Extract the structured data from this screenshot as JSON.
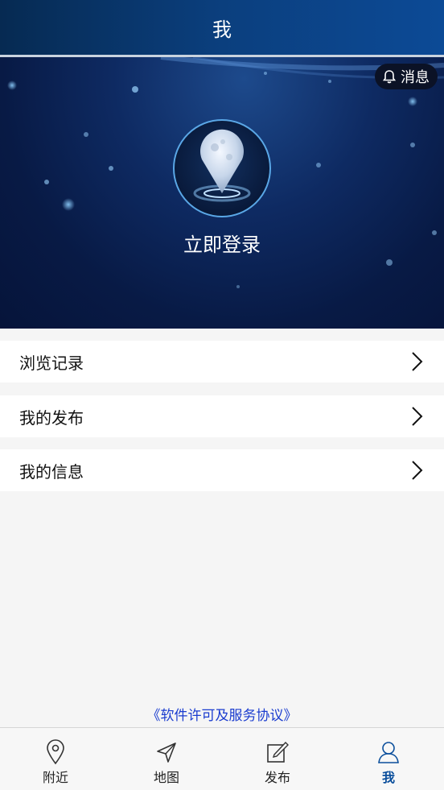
{
  "header": {
    "title": "我"
  },
  "banner": {
    "message_button_label": "消息",
    "login_label": "立即登录"
  },
  "menu": {
    "items": [
      {
        "label": "浏览记录"
      },
      {
        "label": "我的发布"
      },
      {
        "label": "我的信息"
      }
    ]
  },
  "agreement_link": "《软件许可及服务协议》",
  "tabbar": {
    "tabs": [
      {
        "label": "附近",
        "icon": "location-pin-icon",
        "active": false
      },
      {
        "label": "地图",
        "icon": "navigation-arrow-icon",
        "active": false
      },
      {
        "label": "发布",
        "icon": "edit-icon",
        "active": false
      },
      {
        "label": "我",
        "icon": "user-icon",
        "active": true
      }
    ]
  },
  "colors": {
    "header_bg": "#0b3f7e",
    "banner_bg": "#0e2a62",
    "accent": "#0b4f9c",
    "link": "#1a3ccf"
  }
}
